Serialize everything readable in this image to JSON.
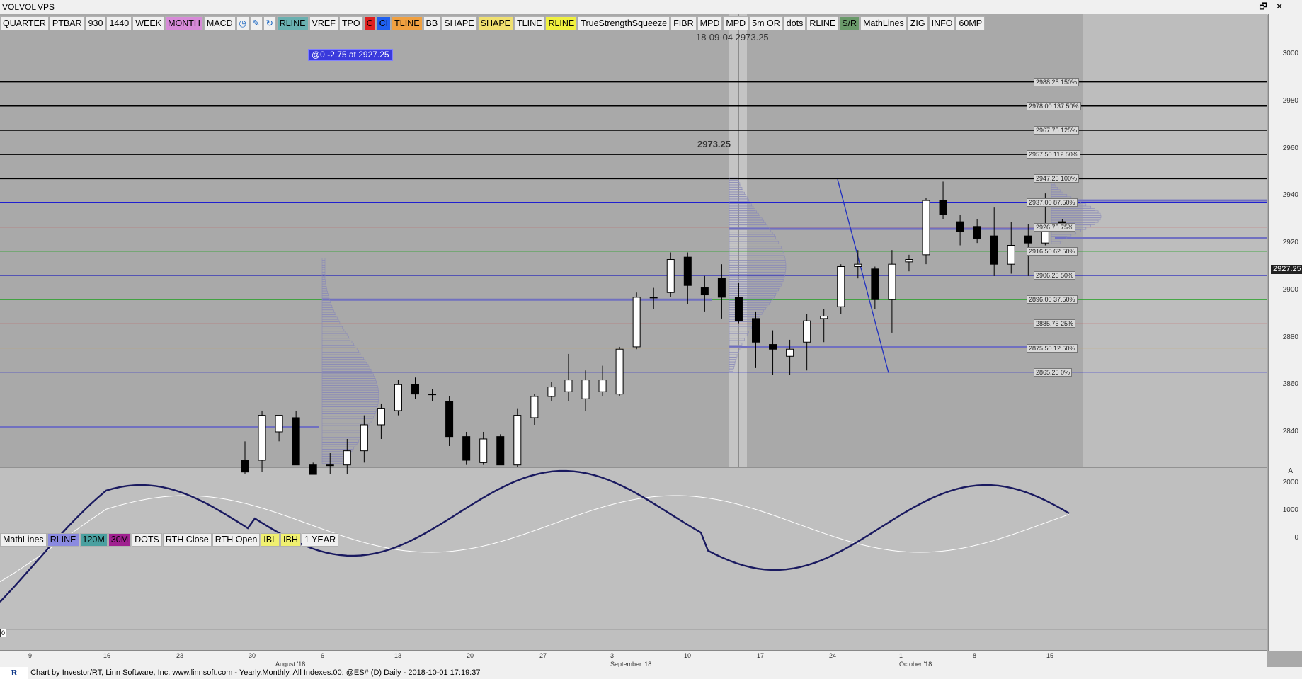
{
  "window": {
    "tabs": [
      "VOL",
      "VOL",
      "VPS"
    ],
    "buttons": {
      "restore": "🗗",
      "close": "✕"
    }
  },
  "toolbar": [
    {
      "label": "QUARTER",
      "bg": "#f0f0f0"
    },
    {
      "label": "PTBAR",
      "bg": "#f0f0f0"
    },
    {
      "label": "930",
      "bg": "#f0f0f0"
    },
    {
      "label": "1440",
      "bg": "#f0f0f0"
    },
    {
      "label": "WEEK",
      "bg": "#f0f0f0"
    },
    {
      "label": "MONTH",
      "bg": "#d78ad8"
    },
    {
      "label": "MACD",
      "bg": "#f0f0f0"
    },
    {
      "label": "",
      "bg": "#f0f0f0",
      "icon": "clock-icon"
    },
    {
      "label": "",
      "bg": "#f0f0f0",
      "icon": "pencil-icon"
    },
    {
      "label": "",
      "bg": "#f0f0f0",
      "icon": "refresh-icon"
    },
    {
      "label": "RLINE",
      "bg": "#6ab0b0"
    },
    {
      "label": "VREF",
      "bg": "#f0f0f0"
    },
    {
      "label": "TPO",
      "bg": "#f0f0f0"
    },
    {
      "label": "C",
      "bg": "#e02020"
    },
    {
      "label": "CI",
      "bg": "#2060f0"
    },
    {
      "label": "TLINE",
      "bg": "#f0a040"
    },
    {
      "label": "BB",
      "bg": "#f0f0f0"
    },
    {
      "label": "SHAPE",
      "bg": "#f0f0f0"
    },
    {
      "label": "SHAPE",
      "bg": "#f0e070"
    },
    {
      "label": "TLINE",
      "bg": "#f0f0f0"
    },
    {
      "label": "RLINE",
      "bg": "#f0f040"
    },
    {
      "label": "TrueStrengthSqueeze",
      "bg": "#f0f0f0"
    },
    {
      "label": "FIBR",
      "bg": "#f0f0f0"
    },
    {
      "label": "MPD",
      "bg": "#f0f0f0"
    },
    {
      "label": "MPD",
      "bg": "#f0f0f0"
    },
    {
      "label": "5m OR",
      "bg": "#f0f0f0"
    },
    {
      "label": "dots",
      "bg": "#f0f0f0"
    },
    {
      "label": "RLINE",
      "bg": "#f0f0f0"
    },
    {
      "label": "S/R",
      "bg": "#6a9a6a"
    },
    {
      "label": "MathLines",
      "bg": "#f0f0f0"
    },
    {
      "label": "ZIG",
      "bg": "#f0f0f0"
    },
    {
      "label": "INFO",
      "bg": "#f0f0f0"
    },
    {
      "label": "60MP",
      "bg": "#f0f0f0"
    }
  ],
  "bottombar": [
    {
      "label": "MathLines",
      "bg": "#f0f0f0"
    },
    {
      "label": "RLINE",
      "bg": "#8a8ae0"
    },
    {
      "label": "120M",
      "bg": "#4aa0a0"
    },
    {
      "label": "30M",
      "bg": "#a02090"
    },
    {
      "label": "DOTS",
      "bg": "#f0f0f0"
    },
    {
      "label": "RTH Close",
      "bg": "#f0f0f0"
    },
    {
      "label": "RTH Open",
      "bg": "#f0f0f0"
    },
    {
      "label": "IBL",
      "bg": "#f0f070"
    },
    {
      "label": "IBH",
      "bg": "#f0f070"
    },
    {
      "label": "1 YEAR",
      "bg": "#f0f0f0"
    }
  ],
  "toast": "@0  -2.75 at 2927.25",
  "crosshair": {
    "date": "18-09-04",
    "price": "2973.25",
    "price_label": "2973.25"
  },
  "price_flag": "2927.25",
  "yaxis": {
    "ticks": [
      "3000",
      "2980",
      "2960",
      "2940",
      "2920",
      "2900",
      "2880",
      "2860",
      "2840"
    ],
    "macd_ticks": [
      "2000",
      "1000",
      "0"
    ],
    "macd_label": "A"
  },
  "levels": [
    {
      "label": "2988.25 150%",
      "color": "#000000"
    },
    {
      "label": "2978.00 137.50%",
      "color": "#000000"
    },
    {
      "label": "2967.75 125%",
      "color": "#000000"
    },
    {
      "label": "2957.50 112.50%",
      "color": "#000000"
    },
    {
      "label": "2947.25 100%",
      "color": "#000000"
    },
    {
      "label": "2937.00 87.50%",
      "color": "#2020d0"
    },
    {
      "label": "2926.75 75%",
      "color": "#d02020"
    },
    {
      "label": "2916.50 62.50%",
      "color": "#20a020"
    },
    {
      "label": "2906.25 50%",
      "color": "#0000c0"
    },
    {
      "label": "2896.00 37.50%",
      "color": "#20a020"
    },
    {
      "label": "2885.75 25%",
      "color": "#d02020"
    },
    {
      "label": "2875.50 12.50%",
      "color": "#d0a040"
    },
    {
      "label": "2865.25 0%",
      "color": "#2020d0"
    }
  ],
  "xaxis": {
    "labels": [
      "9",
      "16",
      "23",
      "30",
      "August '18",
      "6",
      "13",
      "20",
      "27",
      "3",
      "September '18",
      "10",
      "17",
      "24",
      "1",
      "October '18",
      "8",
      "15"
    ]
  },
  "footer": "Chart by Investor/RT, Linn Software, Inc. www.linnsoft.com - Yearly.Monthly.  All Indexes.00: @ES# (D) Daily - 2018-10-01 17:19:37",
  "zero_marker": "0",
  "chart_data": {
    "type": "candlestick",
    "symbol": "@ES# (D) Daily",
    "ylim": [
      2825,
      3010
    ],
    "candles": [
      {
        "o": 2828,
        "h": 2836,
        "l": 2822,
        "c": 2823
      },
      {
        "o": 2828,
        "h": 2849,
        "l": 2823,
        "c": 2847
      },
      {
        "o": 2840,
        "h": 2847,
        "l": 2836,
        "c": 2847
      },
      {
        "o": 2846,
        "h": 2849,
        "l": 2826,
        "c": 2826
      },
      {
        "o": 2826,
        "h": 2827,
        "l": 2822,
        "c": 2822
      },
      {
        "o": 2826,
        "h": 2831,
        "l": 2822,
        "c": 2826
      },
      {
        "o": 2826,
        "h": 2837,
        "l": 2822,
        "c": 2832
      },
      {
        "o": 2832,
        "h": 2847,
        "l": 2827,
        "c": 2843
      },
      {
        "o": 2843,
        "h": 2852,
        "l": 2837,
        "c": 2850
      },
      {
        "o": 2849,
        "h": 2862,
        "l": 2847,
        "c": 2860
      },
      {
        "o": 2860,
        "h": 2863,
        "l": 2854,
        "c": 2856
      },
      {
        "o": 2856,
        "h": 2858,
        "l": 2853,
        "c": 2856
      },
      {
        "o": 2853,
        "h": 2855,
        "l": 2834,
        "c": 2838
      },
      {
        "o": 2838,
        "h": 2840,
        "l": 2826,
        "c": 2828
      },
      {
        "o": 2827,
        "h": 2840,
        "l": 2826,
        "c": 2837
      },
      {
        "o": 2838,
        "h": 2839,
        "l": 2826,
        "c": 2826
      },
      {
        "o": 2826,
        "h": 2850,
        "l": 2825,
        "c": 2847
      },
      {
        "o": 2846,
        "h": 2856,
        "l": 2843,
        "c": 2855
      },
      {
        "o": 2855,
        "h": 2861,
        "l": 2853,
        "c": 2859
      },
      {
        "o": 2857,
        "h": 2873,
        "l": 2853,
        "c": 2862
      },
      {
        "o": 2854,
        "h": 2866,
        "l": 2849,
        "c": 2862
      },
      {
        "o": 2857,
        "h": 2868,
        "l": 2855,
        "c": 2862
      },
      {
        "o": 2856,
        "h": 2876,
        "l": 2855,
        "c": 2875
      },
      {
        "o": 2876,
        "h": 2899,
        "l": 2875,
        "c": 2897
      },
      {
        "o": 2897,
        "h": 2901,
        "l": 2892,
        "c": 2897
      },
      {
        "o": 2899,
        "h": 2916,
        "l": 2897,
        "c": 2913
      },
      {
        "o": 2914,
        "h": 2916,
        "l": 2894,
        "c": 2902
      },
      {
        "o": 2901,
        "h": 2906,
        "l": 2891,
        "c": 2898
      },
      {
        "o": 2905,
        "h": 2911,
        "l": 2888,
        "c": 2897
      },
      {
        "o": 2897,
        "h": 2903,
        "l": 2886,
        "c": 2887
      },
      {
        "o": 2888,
        "h": 2891,
        "l": 2867,
        "c": 2878
      },
      {
        "o": 2877,
        "h": 2883,
        "l": 2864,
        "c": 2875
      },
      {
        "o": 2872,
        "h": 2879,
        "l": 2864,
        "c": 2875
      },
      {
        "o": 2878,
        "h": 2890,
        "l": 2866,
        "c": 2887
      },
      {
        "o": 2888,
        "h": 2892,
        "l": 2878,
        "c": 2889
      },
      {
        "o": 2893,
        "h": 2911,
        "l": 2890,
        "c": 2910
      },
      {
        "o": 2910,
        "h": 2917,
        "l": 2905,
        "c": 2911
      },
      {
        "o": 2909,
        "h": 2910,
        "l": 2892,
        "c": 2896
      },
      {
        "o": 2896,
        "h": 2917,
        "l": 2882,
        "c": 2911
      },
      {
        "o": 2912,
        "h": 2915,
        "l": 2908,
        "c": 2913
      },
      {
        "o": 2915,
        "h": 2939,
        "l": 2911,
        "c": 2938
      },
      {
        "o": 2938,
        "h": 2946,
        "l": 2930,
        "c": 2932
      },
      {
        "o": 2929,
        "h": 2932,
        "l": 2919,
        "c": 2925
      },
      {
        "o": 2927,
        "h": 2930,
        "l": 2920,
        "c": 2922
      },
      {
        "o": 2923,
        "h": 2935,
        "l": 2906,
        "c": 2911
      },
      {
        "o": 2911,
        "h": 2929,
        "l": 2907,
        "c": 2919
      },
      {
        "o": 2923,
        "h": 2928,
        "l": 2906,
        "c": 2920
      },
      {
        "o": 2920,
        "h": 2941,
        "l": 2919,
        "c": 2927
      },
      {
        "o": 2929,
        "h": 2930,
        "l": 2927,
        "c": 2927
      }
    ]
  }
}
